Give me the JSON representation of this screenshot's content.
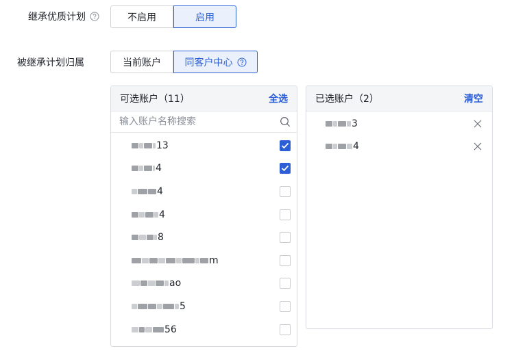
{
  "inherit_plan": {
    "label": "继承优质计划",
    "options": [
      {
        "label": "不启用",
        "active": false
      },
      {
        "label": "启用",
        "active": true
      }
    ]
  },
  "ownership": {
    "label": "被继承计划归属",
    "options": [
      {
        "label": "当前账户",
        "active": false
      },
      {
        "label": "同客户中心",
        "active": true
      }
    ]
  },
  "available": {
    "title": "可选账户（11）",
    "select_all_label": "全选",
    "search_placeholder": "输入账户名称搜索",
    "items": [
      {
        "suffix": "13",
        "checked": true
      },
      {
        "suffix": "4",
        "checked": true
      },
      {
        "suffix": "4",
        "checked": false
      },
      {
        "suffix": "4",
        "checked": false
      },
      {
        "suffix": "8",
        "checked": false
      },
      {
        "suffix": "m",
        "checked": false
      },
      {
        "suffix": "ao",
        "checked": false
      },
      {
        "suffix": "5",
        "checked": false
      },
      {
        "suffix": "56",
        "checked": false
      }
    ]
  },
  "selected": {
    "title": "已选账户（2）",
    "clear_label": "清空",
    "items": [
      {
        "suffix": "3"
      },
      {
        "suffix": "4"
      }
    ]
  },
  "colors": {
    "accent": "#2c5fd6",
    "accent_bg": "#ebf1fc",
    "border": "#d8dbdf",
    "header_bg": "#f4f5f7"
  }
}
